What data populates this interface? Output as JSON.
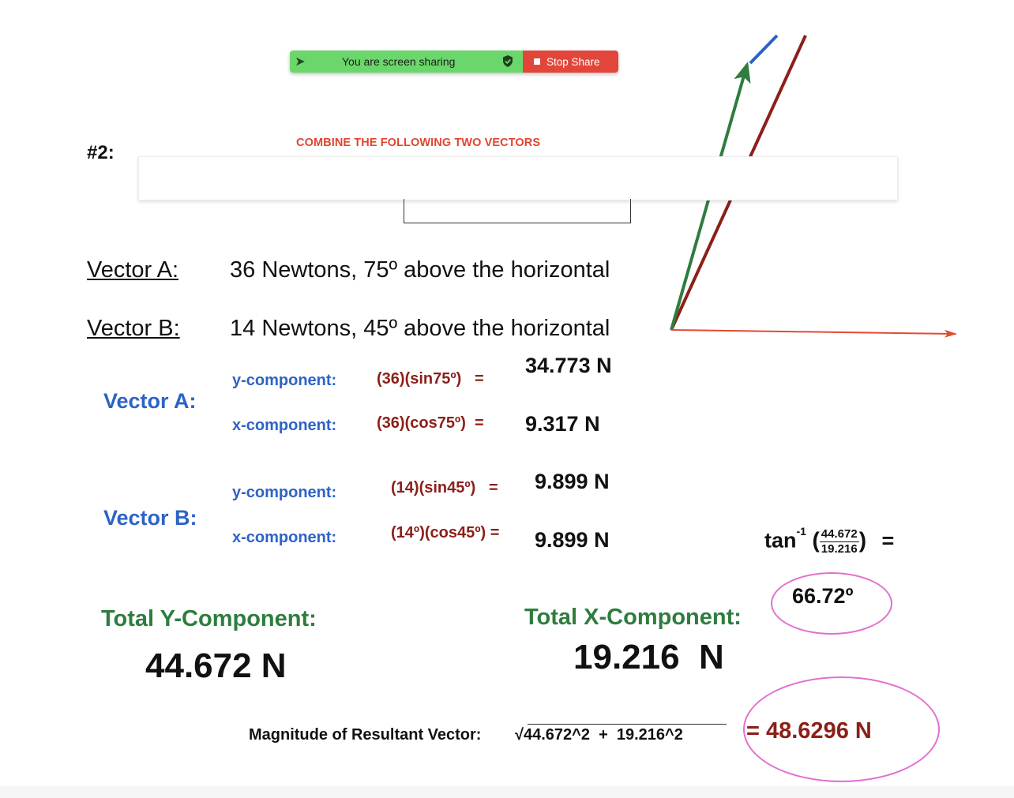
{
  "share_bar": {
    "status_text": "You are screen sharing",
    "stop_label": "Stop Share"
  },
  "problem": {
    "number": "#2:",
    "instruction": "COMBINE THE FOLLOWING TWO VECTORS"
  },
  "vectors": {
    "a_label": "Vector A:",
    "a_desc": "36 Newtons, 75º above the horizontal",
    "b_label": "Vector B:",
    "b_desc": "14 Newtons, 45º above the horizontal"
  },
  "components": {
    "a_heading": "Vector A:",
    "b_heading": "Vector B:",
    "y_label": "y-component:",
    "x_label": "x-component:",
    "a_y_formula": "(36)(sin75º)   =",
    "a_y_result": "34.773 N",
    "a_x_formula": "(36)(cos75º)  =",
    "a_x_result": "9.317 N",
    "b_y_formula": "(14)(sin45º)   =",
    "b_y_result": "9.899 N",
    "b_x_formula": "(14º)(cos45º) =",
    "b_x_result": "9.899 N"
  },
  "totals": {
    "y_heading": "Total Y-Component:",
    "y_value": "44.672 N",
    "x_heading": "Total X-Component:",
    "x_value": "19.216  N"
  },
  "angle": {
    "func": "tan",
    "exponent": "-1",
    "numerator": "44.672",
    "denominator": "19.216",
    "equals": "=",
    "result": "66.72º"
  },
  "magnitude": {
    "label": "Magnitude of Resultant Vector:",
    "radical": "√",
    "expression": "44.672^2  +  19.216^2",
    "result": "= 48.6296 N"
  },
  "colors": {
    "green_arrow": "#2e7d3e",
    "red_arrow": "#8b2019",
    "blue_segment": "#2d63c7",
    "horizontal_arrow": "#e24a33",
    "highlight_ellipse": "#e36fd1"
  }
}
